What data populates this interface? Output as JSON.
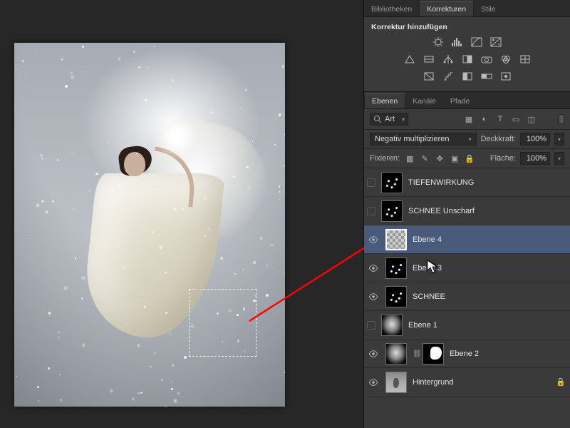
{
  "panel_group_tabs": {
    "bibliotheken": "Bibliotheken",
    "korrekturen": "Korrekturen",
    "stile": "Stile"
  },
  "adjustments_panel": {
    "title": "Korrektur hinzufügen"
  },
  "layers_panel": {
    "tabs": {
      "ebenen": "Ebenen",
      "kanale": "Kanäle",
      "pfade": "Pfade"
    },
    "filter_mode": "Art",
    "blend_mode": "Negativ multiplizieren",
    "opacity_label": "Deckkraft:",
    "opacity_value": "100%",
    "lock_label": "Fixieren:",
    "fill_label": "Fläche:",
    "fill_value": "100%",
    "layers": [
      {
        "name": "TIEFENWIRKUNG",
        "visible": false,
        "thumb": "snowy"
      },
      {
        "name": "SCHNEE Unscharf",
        "visible": false,
        "thumb": "snowy"
      },
      {
        "name": "Ebene 4",
        "visible": true,
        "thumb": "checker",
        "selected": true
      },
      {
        "name": "Ebene 3",
        "visible": true,
        "thumb": "snowy",
        "cursor": true
      },
      {
        "name": "SCHNEE",
        "visible": true,
        "thumb": "snowy"
      },
      {
        "name": "Ebene 1",
        "visible": false,
        "thumb": "hint"
      },
      {
        "name": "Ebene 2",
        "visible": true,
        "thumb": "hint",
        "mask": true
      },
      {
        "name": "Hintergrund",
        "visible": true,
        "thumb": "photo",
        "locked": true
      }
    ]
  }
}
